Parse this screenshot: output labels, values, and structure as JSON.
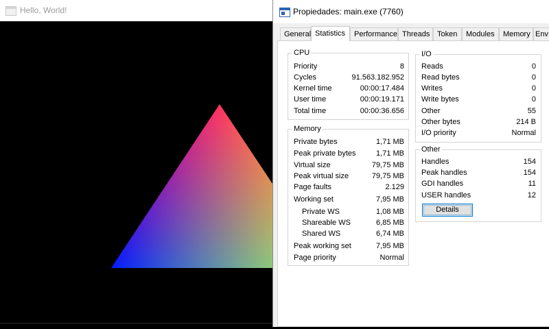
{
  "left_window": {
    "title": "Hello, World!"
  },
  "right_window": {
    "title": "Propiedades: main.exe (7760)",
    "tabs": [
      "General",
      "Statistics",
      "Performance",
      "Threads",
      "Token",
      "Modules",
      "Memory",
      "Env"
    ],
    "active_tab": "Statistics",
    "cpu": {
      "title": "CPU",
      "rows": [
        {
          "label": "Priority",
          "value": "8"
        },
        {
          "label": "Cycles",
          "value": "91.563.182.952"
        },
        {
          "label": "Kernel time",
          "value": "00:00:17.484"
        },
        {
          "label": "User time",
          "value": "00:00:19.171"
        },
        {
          "label": "Total time",
          "value": "00:00:36.656"
        }
      ]
    },
    "memory": {
      "title": "Memory",
      "rows": [
        {
          "label": "Private bytes",
          "value": "1,71 MB"
        },
        {
          "label": "Peak private bytes",
          "value": "1,71 MB"
        },
        {
          "label": "Virtual size",
          "value": "79,75 MB"
        },
        {
          "label": "Peak virtual size",
          "value": "79,75 MB"
        },
        {
          "label": "Page faults",
          "value": "2.129"
        },
        {
          "label": "Working set",
          "value": "7,95 MB"
        },
        {
          "label": "Private WS",
          "value": "1,08 MB"
        },
        {
          "label": "Shareable WS",
          "value": "6,85 MB"
        },
        {
          "label": "Shared WS",
          "value": "6,74 MB"
        },
        {
          "label": "Peak working set",
          "value": "7,95 MB"
        },
        {
          "label": "Page priority",
          "value": "Normal"
        }
      ]
    },
    "io": {
      "title": "I/O",
      "rows": [
        {
          "label": "Reads",
          "value": "0"
        },
        {
          "label": "Read bytes",
          "value": "0"
        },
        {
          "label": "Writes",
          "value": "0"
        },
        {
          "label": "Write bytes",
          "value": "0"
        },
        {
          "label": "Other",
          "value": "55"
        },
        {
          "label": "Other bytes",
          "value": "214 B"
        },
        {
          "label": "I/O priority",
          "value": "Normal"
        }
      ]
    },
    "other": {
      "title": "Other",
      "rows": [
        {
          "label": "Handles",
          "value": "154"
        },
        {
          "label": "Peak handles",
          "value": "154"
        },
        {
          "label": "GDI handles",
          "value": "11"
        },
        {
          "label": "USER handles",
          "value": "12"
        }
      ],
      "details_button": "Details"
    }
  }
}
